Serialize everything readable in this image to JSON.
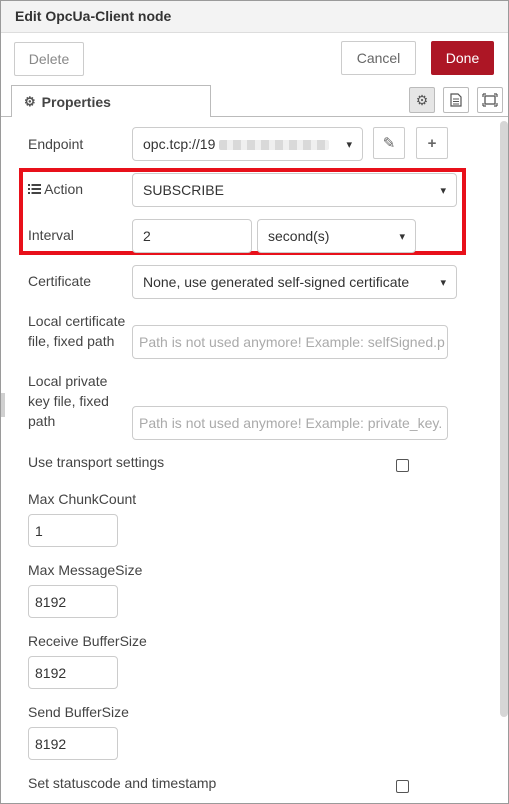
{
  "window": {
    "title": "Edit OpcUa-Client node"
  },
  "toolbar": {
    "delete_label": "Delete",
    "cancel_label": "Cancel",
    "done_label": "Done",
    "done_color": "#ad1625"
  },
  "tabs": {
    "properties_label": "Properties",
    "icons": [
      "gear-icon",
      "document-icon",
      "frame-icon"
    ]
  },
  "form": {
    "endpoint": {
      "label": "Endpoint",
      "value_visible": "opc.tcp://19",
      "edit_icon": "pencil-icon",
      "add_icon": "plus-icon"
    },
    "action": {
      "label": "Action",
      "icon": "list-icon",
      "selected": "SUBSCRIBE"
    },
    "interval": {
      "label": "Interval",
      "value": "2",
      "unit_selected": "second(s)"
    },
    "certificate": {
      "label": "Certificate",
      "selected": "None, use generated self-signed certificate"
    },
    "local_cert": {
      "label_line1": "Local certificate",
      "label_line2": "file, fixed path",
      "placeholder": "Path is not used anymore! Example: selfSigned.p"
    },
    "local_key": {
      "label_line1": "Local private",
      "label_line2": "key file, fixed",
      "label_line3": "path",
      "placeholder": "Path is not used anymore! Example: private_key."
    },
    "use_transport": {
      "label": "Use transport settings",
      "checked": false
    },
    "max_chunk": {
      "label": "Max ChunkCount",
      "value": "1"
    },
    "max_message": {
      "label": "Max MessageSize",
      "value": "8192"
    },
    "receive_buffer": {
      "label": "Receive BufferSize",
      "value": "8192"
    },
    "send_buffer": {
      "label": "Send BufferSize",
      "value": "8192"
    },
    "set_status": {
      "label": "Set statuscode and timestamp",
      "checked": false
    }
  },
  "highlight_color": "#e8101a"
}
